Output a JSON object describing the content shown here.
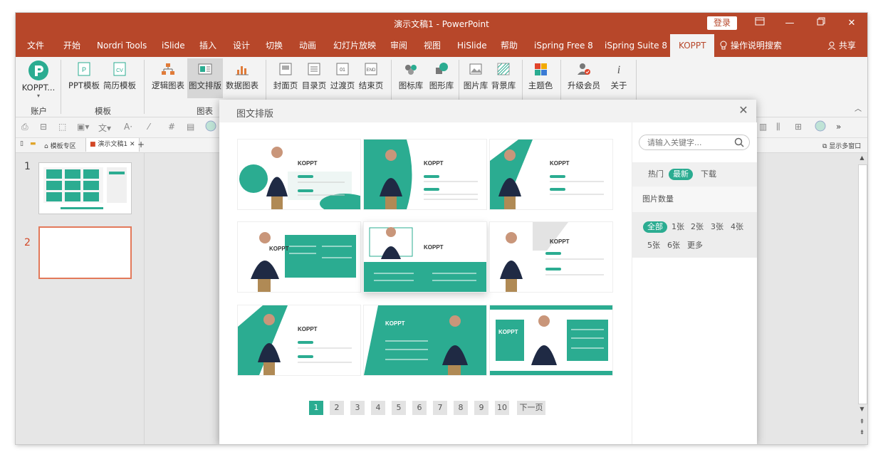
{
  "window": {
    "title": "演示文稿1 - PowerPoint",
    "login_label": "登录"
  },
  "tabs": [
    "文件",
    "开始",
    "Nordri Tools",
    "iSlide",
    "插入",
    "设计",
    "切换",
    "动画",
    "幻灯片放映",
    "审阅",
    "视图",
    "HiSlide",
    "帮助",
    "iSpring Free 8",
    "iSpring Suite 8",
    "KOPPT",
    "操作说明搜索",
    "共享"
  ],
  "active_tab": "KOPPT",
  "ribbon": {
    "buttons": [
      "KOPPT...",
      "PPT模板",
      "简历模板",
      "逻辑图表",
      "图文排版",
      "数据图表",
      "封面页",
      "目录页",
      "过渡页",
      "结束页",
      "图标库",
      "图形库",
      "图片库",
      "背景库",
      "主题色",
      "升级会员",
      "关于"
    ],
    "groups": [
      "账户",
      "模板",
      "图表"
    ]
  },
  "doc_tabs": [
    "模板专区",
    "演示文稿1"
  ],
  "show_window": "显示多窗口",
  "slides": [
    "1",
    "2"
  ],
  "dialog": {
    "title": "图文排版",
    "cards": [
      {
        "title": "KOPPT",
        "variant": "a"
      },
      {
        "title": "KOPPT",
        "variant": "b"
      },
      {
        "title": "KOPPT",
        "variant": "c"
      },
      {
        "title": "KOPPT",
        "variant": "d"
      },
      {
        "title": "KOPPT",
        "variant": "e"
      },
      {
        "title": "KOPPT",
        "variant": "f"
      },
      {
        "title": "KOPPT",
        "variant": "g"
      },
      {
        "title": "KOPPT",
        "variant": "h"
      },
      {
        "title": "KOPPT",
        "variant": "i"
      }
    ],
    "pages": [
      "1",
      "2",
      "3",
      "4",
      "5",
      "6",
      "7",
      "8",
      "9",
      "10"
    ],
    "next_label": "下一页",
    "search_placeholder": "请输入关键字...",
    "sort_options": [
      "热门",
      "最新",
      "下载"
    ],
    "count_label": "图片数量",
    "count_options": [
      "全部",
      "1张",
      "2张",
      "3张",
      "4张",
      "5张",
      "6张",
      "更多"
    ]
  },
  "colors": {
    "accent": "#b7472a",
    "teal": "#2bac91"
  }
}
